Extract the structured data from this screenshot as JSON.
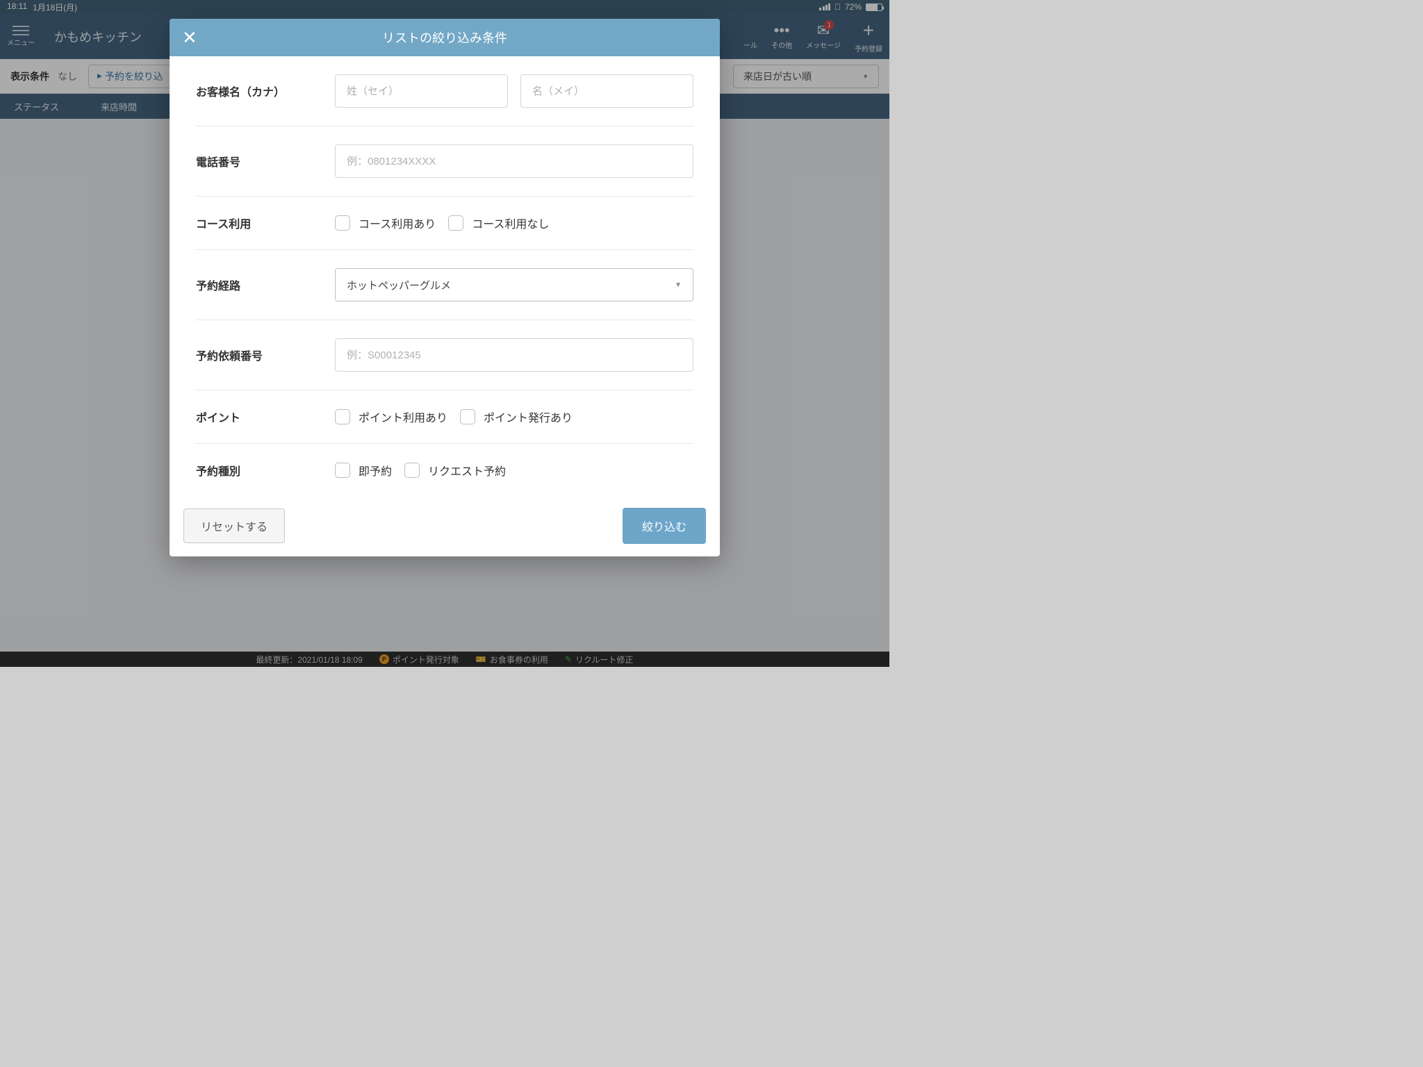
{
  "statusbar": {
    "time": "18:11",
    "date": "1月18日(月)",
    "battery_pct": "72%"
  },
  "header": {
    "menu_label": "メニュー",
    "app_title": "かもめキッチン",
    "other_label": "その他",
    "messages_label": "メッセージ",
    "message_badge": "1",
    "cutoff_label": "ール",
    "register_label": "予約登録"
  },
  "filterbar": {
    "caption": "表示条件",
    "value": "なし",
    "filter_btn": "予約を絞り込",
    "sort_value": "来店日が古い順"
  },
  "tablehdr": {
    "status": "ステータス",
    "visit_time": "来店時間"
  },
  "modal": {
    "title": "リストの絞り込み条件",
    "rows": {
      "customer_name_label": "お客様名（カナ）",
      "sei_placeholder": "姓（セイ）",
      "mei_placeholder": "名（メイ）",
      "phone_label": "電話番号",
      "phone_placeholder": "例：0801234XXXX",
      "course_label": "コース利用",
      "course_yes": "コース利用あり",
      "course_no": "コース利用なし",
      "route_label": "予約経路",
      "route_value": "ホットペッパーグルメ",
      "request_no_label": "予約依頼番号",
      "request_no_placeholder": "例：S00012345",
      "points_label": "ポイント",
      "points_use": "ポイント利用あり",
      "points_issue": "ポイント発行あり",
      "type_label": "予約種別",
      "type_instant": "即予約",
      "type_request": "リクエスト予約"
    },
    "reset_btn": "リセットする",
    "apply_btn": "絞り込む"
  },
  "footer": {
    "updated": "最終更新：2021/01/18 18:09",
    "point_target": "ポイント発行対象",
    "voucher": "お食事券の利用",
    "recruit": "リクルート修正"
  }
}
